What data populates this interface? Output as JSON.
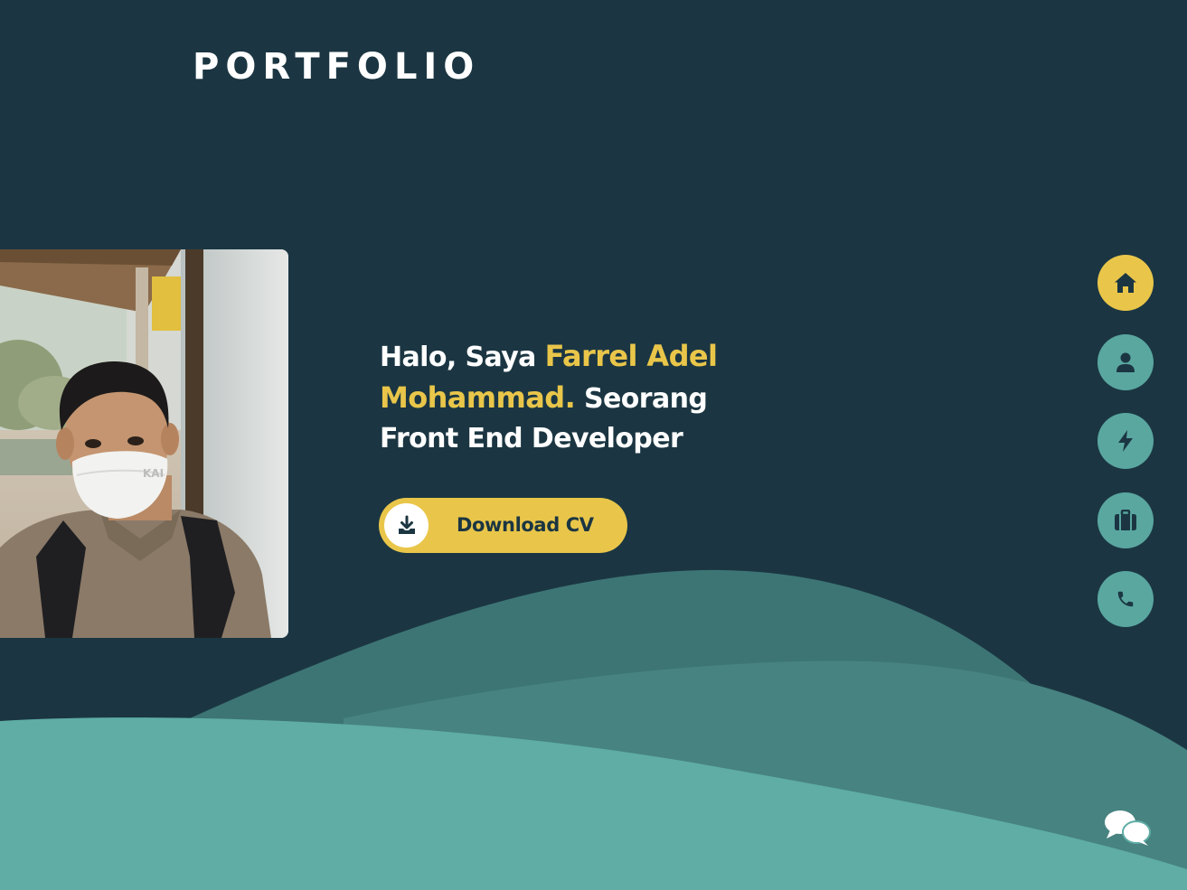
{
  "header": {
    "logo_text": "PORTFOLIO"
  },
  "hero": {
    "greeting": "Halo, Saya ",
    "name": "Farrel Adel Mohammad.",
    "role": " Seorang Front End Developer",
    "photo_alt": "Farrel Adel Mohammad",
    "download_label": "Download CV",
    "download_icon": "download-icon"
  },
  "nav": {
    "items": [
      {
        "name": "home",
        "icon": "home-icon",
        "active": true
      },
      {
        "name": "about",
        "icon": "user-icon",
        "active": false
      },
      {
        "name": "skills",
        "icon": "bolt-icon",
        "active": false
      },
      {
        "name": "portfolio",
        "icon": "briefcase-icon",
        "active": false
      },
      {
        "name": "contact",
        "icon": "phone-icon",
        "active": false
      }
    ]
  },
  "chat": {
    "icon": "chat-icon"
  },
  "colors": {
    "background": "#1b3642",
    "accent": "#e9c64a",
    "teal": "#5aa7a0",
    "wave_dark": "#3d7574",
    "wave_mid": "#478380",
    "wave_light": "#5fada5",
    "text": "#ffffff"
  }
}
